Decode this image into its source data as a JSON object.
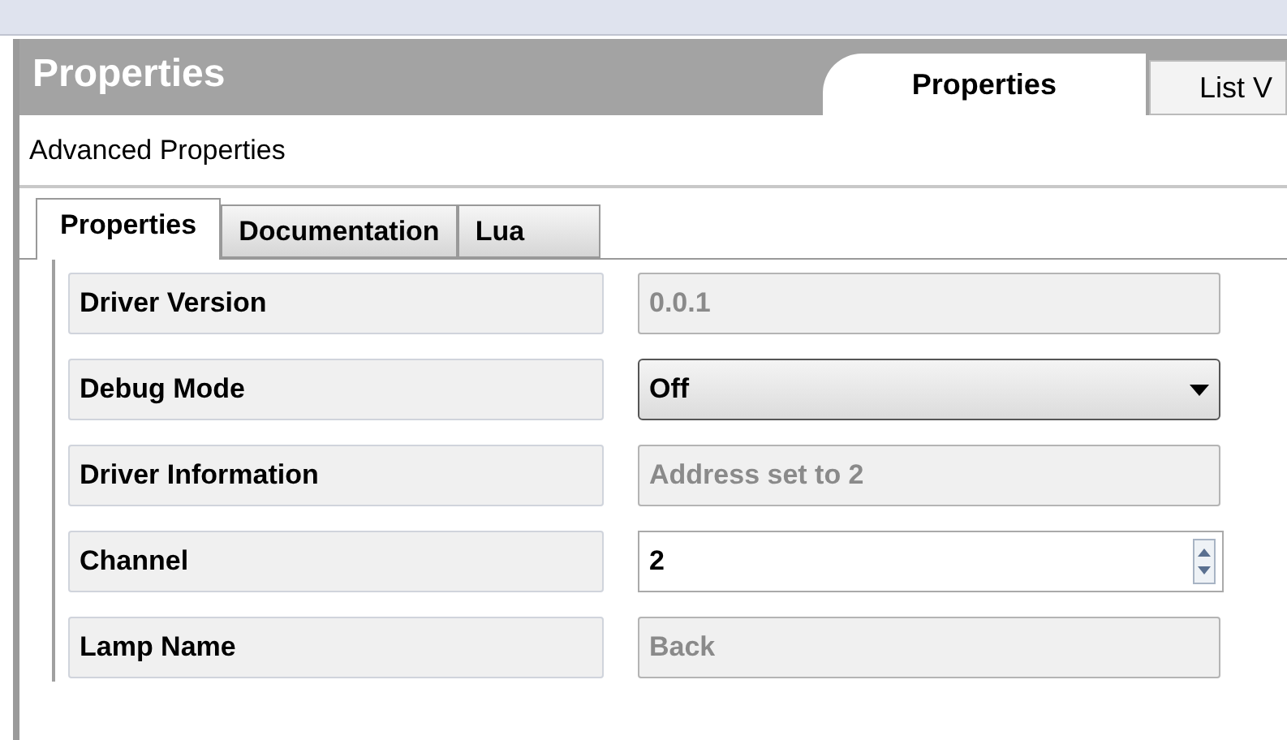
{
  "header": {
    "title": "Properties"
  },
  "view_tabs": [
    {
      "label": "Properties",
      "selected": true
    },
    {
      "label": "List V",
      "selected": false
    }
  ],
  "subheader": "Advanced Properties",
  "tabs": [
    {
      "label": "Properties",
      "selected": true
    },
    {
      "label": "Documentation",
      "selected": false
    },
    {
      "label": "Lua",
      "selected": false
    }
  ],
  "properties": [
    {
      "label": "Driver Version",
      "kind": "readonly",
      "value": "0.0.1"
    },
    {
      "label": "Debug Mode",
      "kind": "dropdown",
      "value": "Off"
    },
    {
      "label": "Driver Information",
      "kind": "readonly",
      "value": "Address set to 2"
    },
    {
      "label": "Channel",
      "kind": "spin",
      "value": "2"
    },
    {
      "label": "Lamp Name",
      "kind": "readonly",
      "value": "Back"
    }
  ]
}
